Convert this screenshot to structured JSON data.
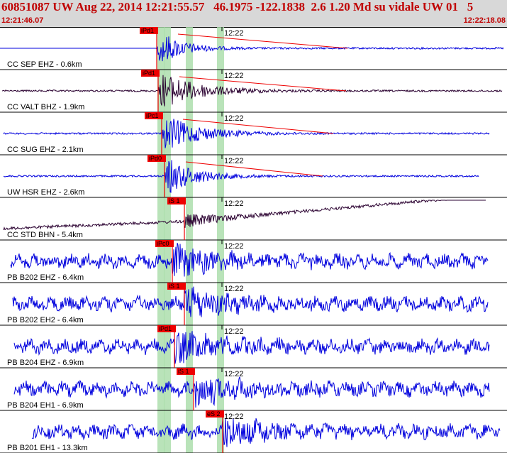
{
  "header": {
    "title": "60851087 UW Aug 22, 2014 12:21:55.57   46.1975 -122.1838  2.6 1.20 Md su vidale UW 01   5",
    "start_time": "12:21:46.07",
    "end_time": "12:22:18.08"
  },
  "colors": {
    "trace_blue": "#0000dd",
    "trace_dark": "#2a0030",
    "pick_red": "#ee0000",
    "band_green": "#a8dca8",
    "header_red": "#c00000"
  },
  "traces": [
    {
      "label": "CC SEP EHZ - 0.6km",
      "time_label": "12:22",
      "pick": "iPd1",
      "color": "blue",
      "style": "spike"
    },
    {
      "label": "CC VALT BHZ - 1.9km",
      "time_label": "12:22",
      "pick": "iPd1",
      "color": "dark",
      "style": "spike"
    },
    {
      "label": "CC SUG EHZ - 2.1km",
      "time_label": "12:22",
      "pick": "iPc1",
      "color": "blue",
      "style": "spike"
    },
    {
      "label": "UW HSR EHZ - 2.6km",
      "time_label": "12:22",
      "pick": "iPd0",
      "color": "blue",
      "style": "spike"
    },
    {
      "label": "CC STD BHN - 5.4km",
      "time_label": "12:22",
      "pick": "iS 1",
      "color": "dark",
      "style": "drift"
    },
    {
      "label": "PB B202 EHZ - 6.4km",
      "time_label": "12:22",
      "pick": "iPc0",
      "color": "blue",
      "style": "noise"
    },
    {
      "label": "PB B202 EH2 - 6.4km",
      "time_label": "12:22",
      "pick": "iS 1",
      "color": "blue",
      "style": "noise"
    },
    {
      "label": "PB B204 EHZ - 6.9km",
      "time_label": "12:22",
      "pick": "iPd1",
      "color": "blue",
      "style": "noise"
    },
    {
      "label": "PB B204 EH1 - 6.9km",
      "time_label": "12:22",
      "pick": "iS 1",
      "color": "blue",
      "style": "noise"
    },
    {
      "label": "PB B201 EH1 - 13.3km",
      "time_label": "12:22",
      "pick": "eS 2",
      "color": "blue",
      "style": "noise"
    }
  ]
}
